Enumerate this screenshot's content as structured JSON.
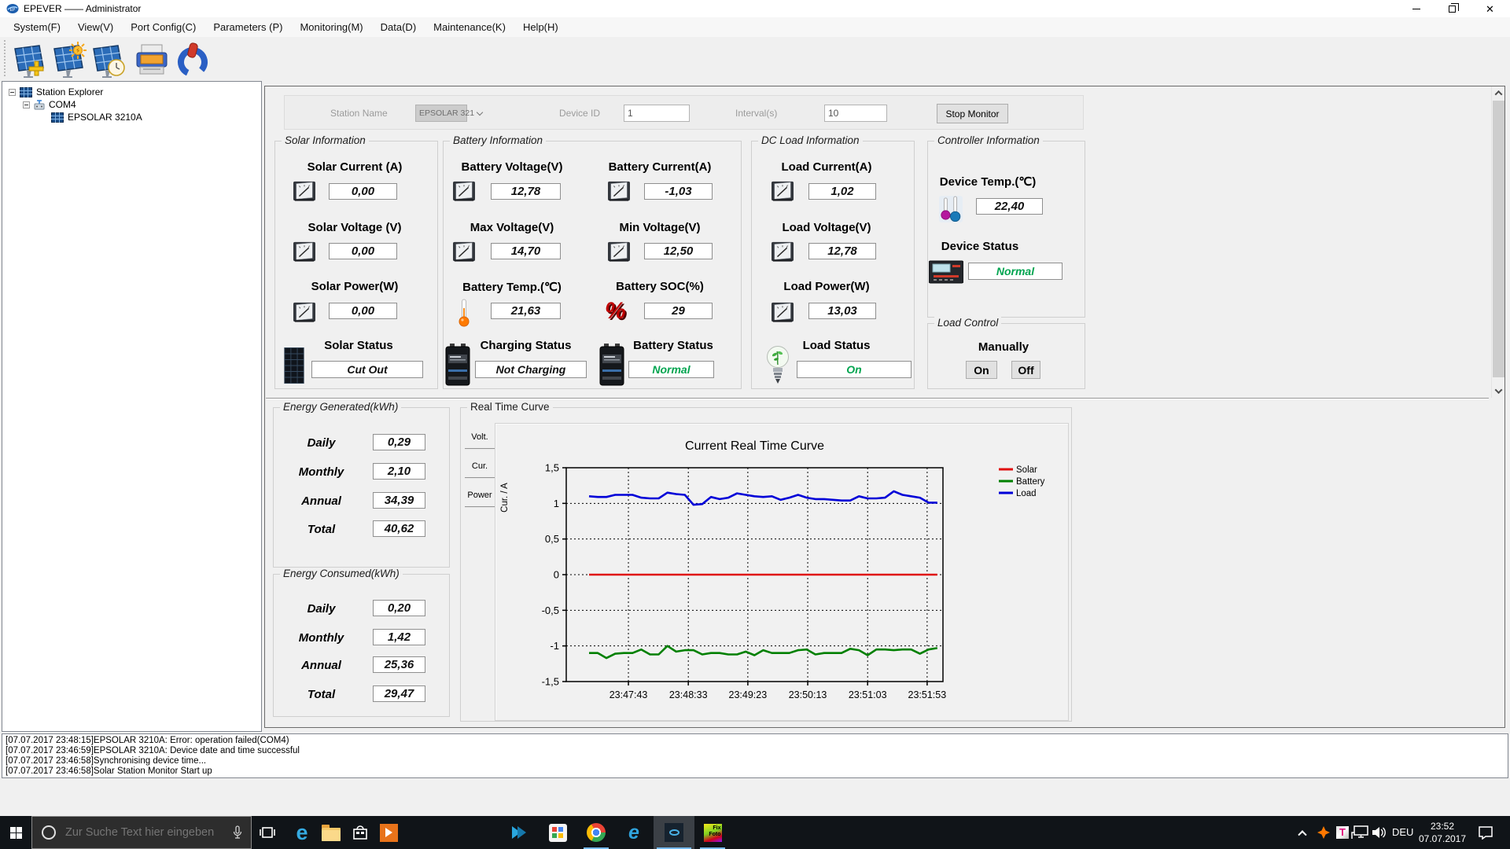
{
  "window": {
    "title": "EPEVER —— Administrator"
  },
  "menu": {
    "items": [
      "System(F)",
      "View(V)",
      "Port Config(C)",
      "Parameters (P)",
      "Monitoring(M)",
      "Data(D)",
      "Maintenance(K)",
      "Help(H)"
    ]
  },
  "tree": {
    "root": "Station Explorer",
    "port": "COM4",
    "device": "EPSOLAR 3210A"
  },
  "monitor_bar": {
    "station_name_label": "Station Name",
    "station_name_value": "EPSOLAR 321",
    "device_id_label": "Device ID",
    "device_id_value": "1",
    "interval_label": "Interval(s)",
    "interval_value": "10",
    "stop_button": "Stop Monitor"
  },
  "solar_info": {
    "title": "Solar Information",
    "fields": [
      {
        "label": "Solar Current (A)",
        "value": "0,00"
      },
      {
        "label": "Solar Voltage (V)",
        "value": "0,00"
      },
      {
        "label": "Solar Power(W)",
        "value": "0,00"
      }
    ],
    "status_label": "Solar Status",
    "status_value": "Cut Out"
  },
  "battery_info": {
    "title": "Battery Information",
    "fields": [
      {
        "label": "Battery Voltage(V)",
        "value": "12,78"
      },
      {
        "label": "Battery Current(A)",
        "value": "-1,03"
      },
      {
        "label": "Max Voltage(V)",
        "value": "14,70"
      },
      {
        "label": "Min Voltage(V)",
        "value": "12,50"
      },
      {
        "label": "Battery Temp.(℃)",
        "value": "21,63"
      },
      {
        "label": "Battery SOC(%)",
        "value": "29"
      }
    ],
    "charging_status_label": "Charging Status",
    "charging_status_value": "Not Charging",
    "battery_status_label": "Battery Status",
    "battery_status_value": "Normal"
  },
  "load_info": {
    "title": "DC Load Information",
    "fields": [
      {
        "label": "Load Current(A)",
        "value": "1,02"
      },
      {
        "label": "Load Voltage(V)",
        "value": "12,78"
      },
      {
        "label": "Load Power(W)",
        "value": "13,03"
      }
    ],
    "status_label": "Load Status",
    "status_value": "On"
  },
  "controller_info": {
    "title": "Controller Information",
    "temp_label": "Device Temp.(℃)",
    "temp_value": "22,40",
    "status_label": "Device Status",
    "status_value": "Normal"
  },
  "load_control": {
    "title": "Load Control",
    "manually_label": "Manually",
    "on_button": "On",
    "off_button": "Off"
  },
  "energy_generated": {
    "title": "Energy Generated(kWh)",
    "rows": [
      {
        "label": "Daily",
        "value": "0,29"
      },
      {
        "label": "Monthly",
        "value": "2,10"
      },
      {
        "label": "Annual",
        "value": "34,39"
      },
      {
        "label": "Total",
        "value": "40,62"
      }
    ]
  },
  "energy_consumed": {
    "title": "Energy Consumed(kWh)",
    "rows": [
      {
        "label": "Daily",
        "value": "0,20"
      },
      {
        "label": "Monthly",
        "value": "1,42"
      },
      {
        "label": "Annual",
        "value": "25,36"
      },
      {
        "label": "Total",
        "value": "29,47"
      }
    ]
  },
  "curve_panel": {
    "title": "Real Time Curve",
    "tabs": [
      "Volt.",
      "Cur.",
      "Power"
    ]
  },
  "chart_data": {
    "type": "line",
    "title": "Current Real Time Curve",
    "ylabel": "Cur. / A",
    "ylim": [
      -1.5,
      1.5
    ],
    "ytick_labels": [
      "1,5",
      "1",
      "0,5",
      "0",
      "-0,5",
      "-1",
      "-1,5"
    ],
    "x_tick_labels": [
      "23:47:43",
      "23:48:33",
      "23:49:23",
      "23:50:13",
      "23:51:03",
      "23:51:53"
    ],
    "grid": true,
    "legend_position": "right-top",
    "series": [
      {
        "name": "Solar",
        "color": "#e01010",
        "values": [
          0,
          0,
          0,
          0,
          0,
          0,
          0,
          0,
          0,
          0,
          0,
          0,
          0,
          0,
          0,
          0,
          0,
          0,
          0,
          0,
          0,
          0,
          0,
          0,
          0,
          0,
          0,
          0,
          0,
          0,
          0,
          0,
          0,
          0,
          0,
          0,
          0,
          0,
          0,
          0,
          0
        ]
      },
      {
        "name": "Battery",
        "color": "#008000",
        "values": [
          -1.1,
          -1.1,
          -1.17,
          -1.11,
          -1.1,
          -1.1,
          -1.05,
          -1.12,
          -1.12,
          -1.0,
          -1.08,
          -1.06,
          -1.06,
          -1.12,
          -1.1,
          -1.1,
          -1.12,
          -1.12,
          -1.08,
          -1.13,
          -1.06,
          -1.1,
          -1.1,
          -1.1,
          -1.06,
          -1.05,
          -1.12,
          -1.1,
          -1.1,
          -1.1,
          -1.04,
          -1.06,
          -1.13,
          -1.05,
          -1.05,
          -1.06,
          -1.05,
          -1.05,
          -1.11,
          -1.05,
          -1.03
        ]
      },
      {
        "name": "Load",
        "color": "#0000d8",
        "values": [
          1.1,
          1.09,
          1.09,
          1.12,
          1.12,
          1.12,
          1.08,
          1.07,
          1.07,
          1.15,
          1.13,
          1.12,
          0.98,
          0.99,
          1.09,
          1.06,
          1.08,
          1.14,
          1.12,
          1.1,
          1.09,
          1.1,
          1.05,
          1.08,
          1.12,
          1.08,
          1.06,
          1.06,
          1.05,
          1.04,
          1.04,
          1.1,
          1.07,
          1.07,
          1.08,
          1.17,
          1.12,
          1.1,
          1.08,
          1.01,
          1.01
        ]
      }
    ]
  },
  "log": {
    "lines": [
      "[07.07.2017 23:48:15]EPSOLAR 3210A: Error: operation failed(COM4)",
      "[07.07.2017 23:46:59]EPSOLAR 3210A: Device date and time successful",
      "[07.07.2017 23:46:58]Synchronising device time...",
      "[07.07.2017 23:46:58]Solar Station Monitor Start up"
    ]
  },
  "taskbar": {
    "search_placeholder": "Zur Suche Text hier eingeben",
    "language": "DEU",
    "time": "23:52",
    "date": "07.07.2017"
  }
}
